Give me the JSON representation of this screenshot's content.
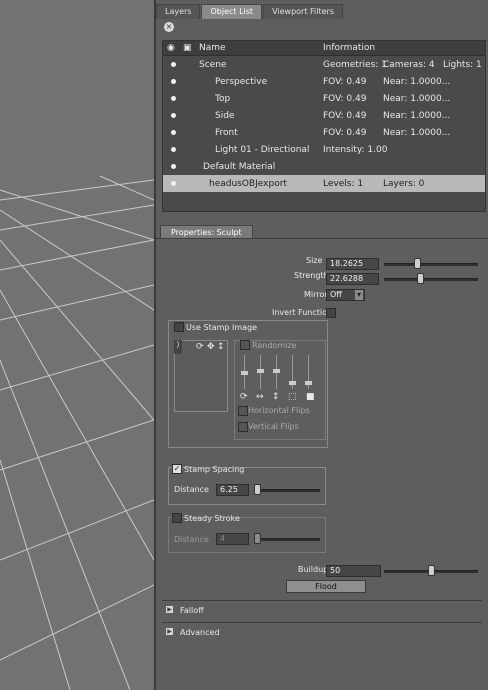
{
  "tabs": [
    "Layers",
    "Object List",
    "Viewport Filters"
  ],
  "active_tab": 1,
  "object_list": {
    "header": {
      "name": "Name",
      "info": "Information"
    },
    "rows": [
      {
        "name": "Scene",
        "info1": "Geometries: 1",
        "info2": "Cameras: 4",
        "info3": "Lights: 1"
      },
      {
        "name": "Perspective",
        "info1": "FOV: 0.49",
        "info2": "Near: 1.0000...",
        "info3": ""
      },
      {
        "name": "Top",
        "info1": "FOV: 0.49",
        "info2": "Near: 1.0000...",
        "info3": ""
      },
      {
        "name": "Side",
        "info1": "FOV: 0.49",
        "info2": "Near: 1.0000...",
        "info3": ""
      },
      {
        "name": "Front",
        "info1": "FOV: 0.49",
        "info2": "Near: 1.0000...",
        "info3": ""
      },
      {
        "name": "Light 01 - Directional",
        "info1": "Intensity: 1.00",
        "info2": "",
        "info3": ""
      },
      {
        "name": "Default Material",
        "info1": "",
        "info2": "",
        "info3": ""
      },
      {
        "name": "headusOBJexport",
        "info1": "Levels: 1",
        "info2": "Layers: 0",
        "info3": ""
      }
    ],
    "selected_row": 7
  },
  "properties": {
    "tab": "Properties: Sculpt",
    "size_label": "Size",
    "size_value": "18.2625",
    "size_level": 0.35,
    "strength_label": "Strength",
    "strength_value": "22.6288",
    "strength_level": 0.38,
    "mirror_label": "Mirror",
    "mirror_value": "Off",
    "invert_label": "Invert Function",
    "stamp_image_label": "Use Stamp Image",
    "randomize_label": "Randomize",
    "horizontal_flips_label": "Horizontal Flips",
    "vertical_flips_label": "Vertical Flips",
    "stamp_spacing_label": "Stamp Spacing",
    "distance_label": "Distance",
    "distance_value": "6.25",
    "distance_level": 0.05,
    "steady_stroke_label": "Steady Stroke",
    "steady_distance_label": "Distance",
    "steady_distance_value": "4",
    "steady_distance_level": 0.05,
    "buildup_label": "Buildup",
    "buildup_value": "50",
    "buildup_level": 0.5,
    "flood_label": "Flood",
    "falloff_label": "Falloff",
    "advanced_label": "Advanced"
  },
  "icons": {
    "close": "close-icon",
    "eye": "eye-icon",
    "lock": "lock-icon",
    "camera": "camera-icon",
    "light": "light-bulb-icon"
  }
}
